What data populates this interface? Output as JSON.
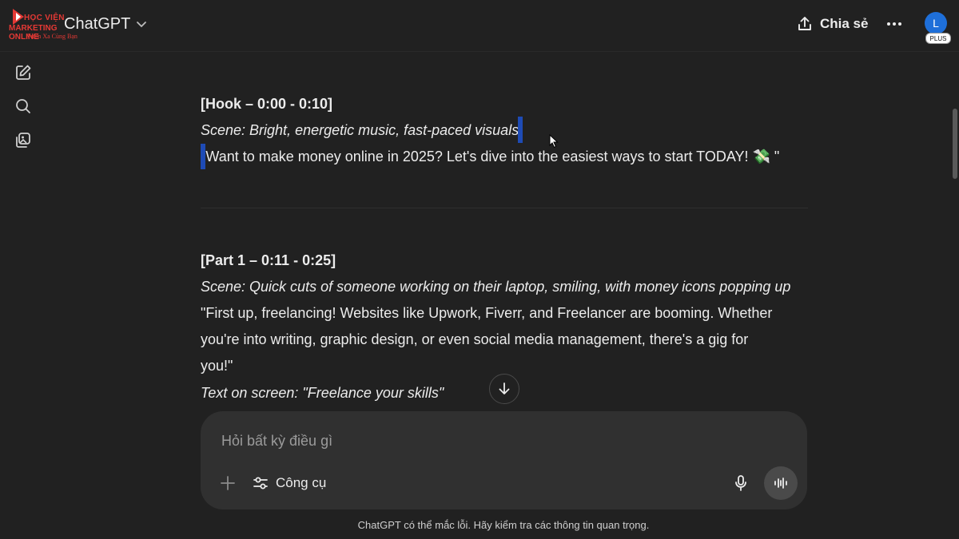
{
  "header": {
    "logo": {
      "line1": "HỌC VIỆN",
      "line2": "MARKETING ONLINE",
      "tagline": "Vươn Xa Cùng Bạn"
    },
    "model_name": "ChatGPT",
    "share_label": "Chia sẻ",
    "avatar_initial": "L",
    "plan_badge": "PLUS"
  },
  "conversation": {
    "hook": {
      "heading": "[Hook – 0:00 - 0:10]",
      "scene": "Scene: Bright, energetic music, fast-paced visuals",
      "quote": "\"Want to make money online in 2025? Let's dive into the easiest ways to start TODAY! 💸 \""
    },
    "part1": {
      "heading": "[Part 1 – 0:11 - 0:25]",
      "scene": "Scene: Quick cuts of someone working on their laptop, smiling, with money icons popping up",
      "quote_lines": [
        "\"First up, freelancing! Websites like Upwork, Fiverr, and Freelancer are booming. Whether",
        "you're into writing, graphic design, or even social media management, there's a gig for",
        "you!\""
      ],
      "screen_text": "Text on screen: \"Freelance your skills\""
    }
  },
  "composer": {
    "placeholder": "Hỏi bất kỳ điều gì",
    "tools_label": "Công cụ"
  },
  "footer": {
    "disclaimer": "ChatGPT có thể mắc lỗi. Hãy kiểm tra các thông tin quan trọng."
  },
  "colors": {
    "background": "#212121",
    "composer": "#303030",
    "text": "#ececec",
    "selection_caret": "#1e4bb5",
    "avatar": "#1e6fd9",
    "logo_red": "#e53935"
  }
}
